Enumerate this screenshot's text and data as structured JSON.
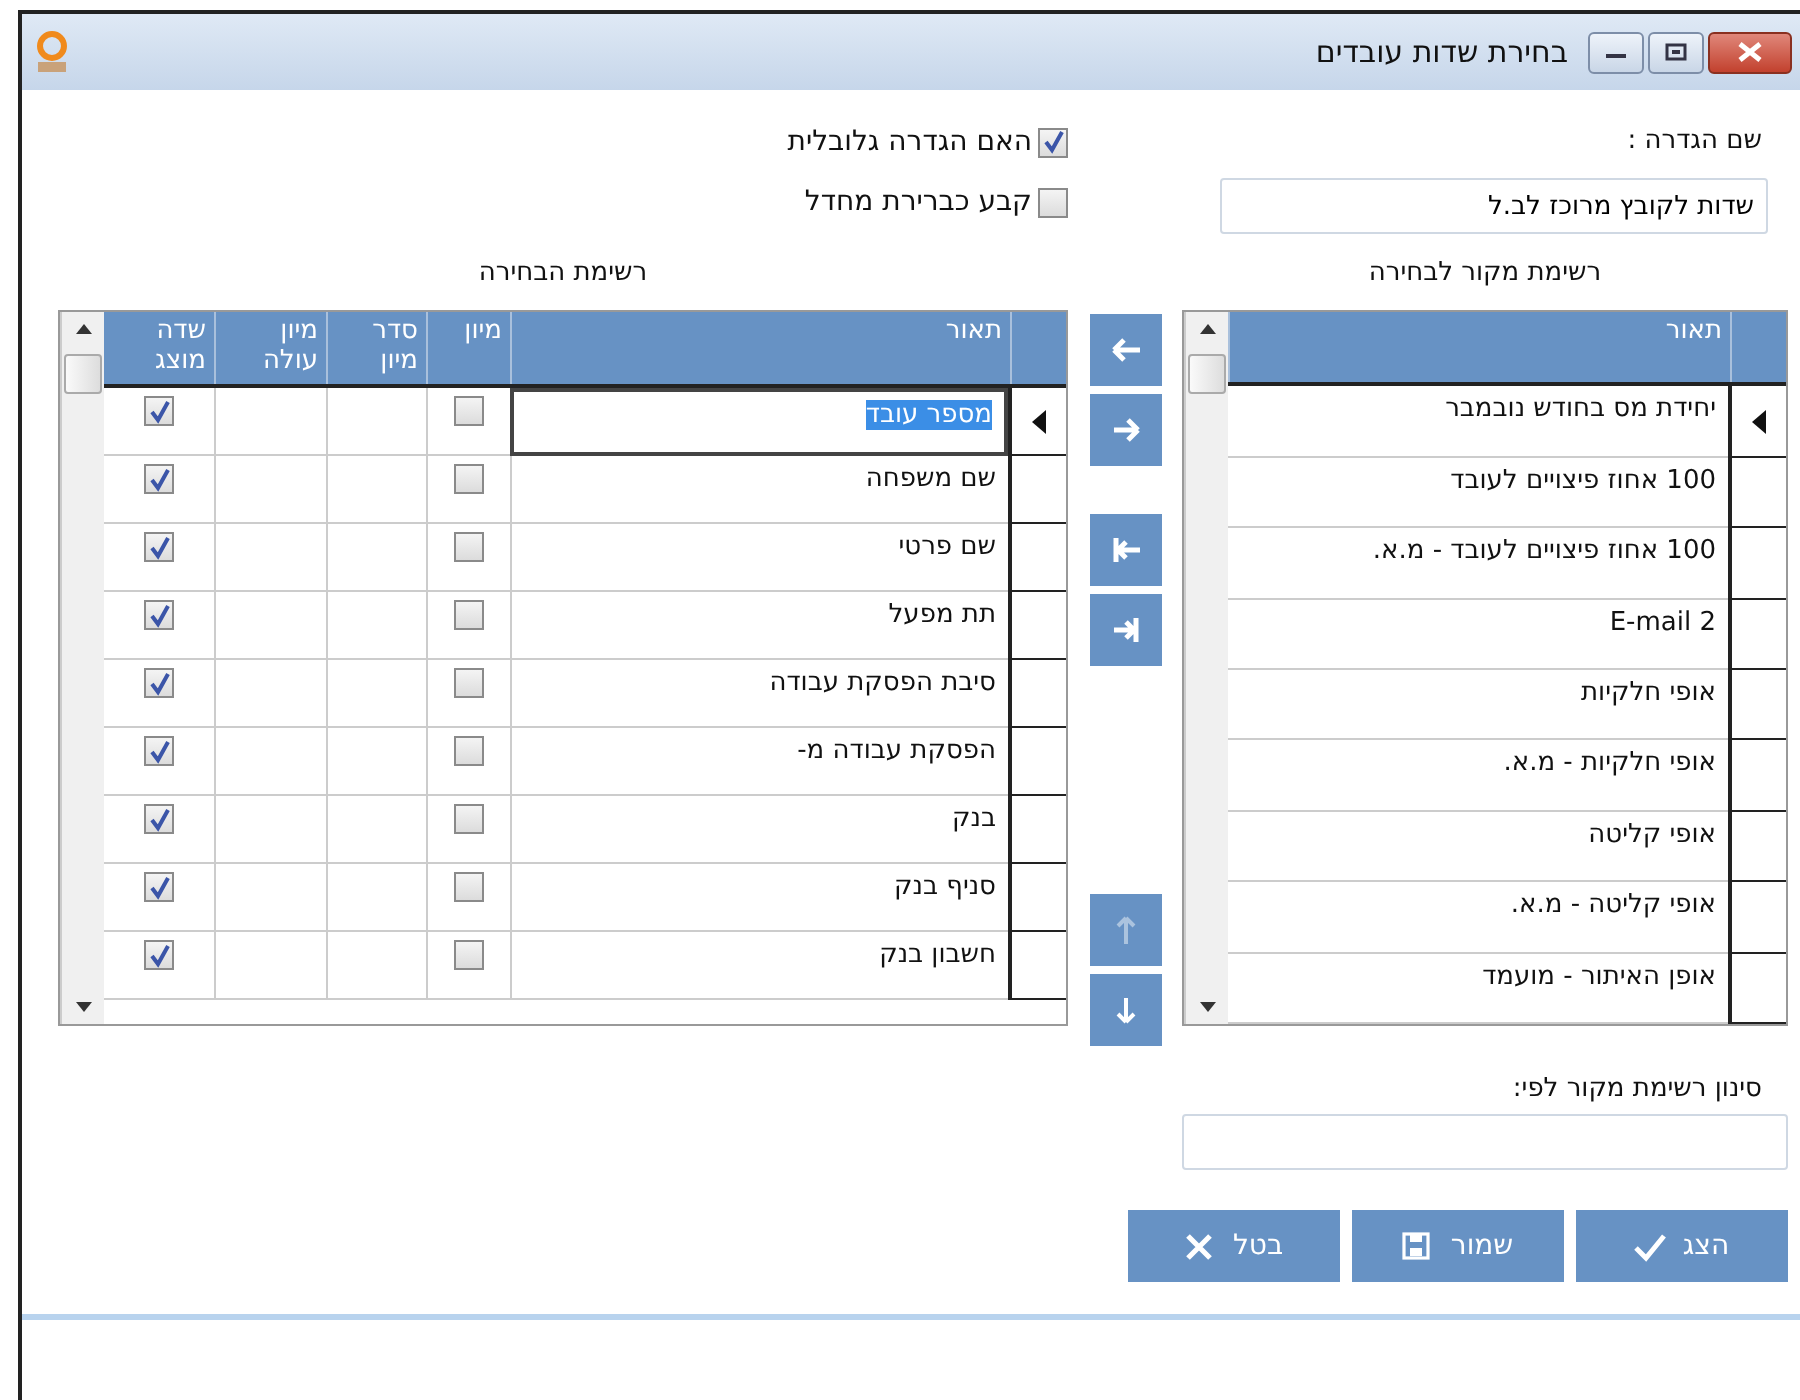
{
  "window": {
    "title": "בחירת שדות עובדים"
  },
  "definition": {
    "label": "שם הגדרה :",
    "value": "שדות לקובץ מרוכז לב.ל"
  },
  "options": [
    {
      "label": "האם הגדרה גלובלית",
      "checked": true
    },
    {
      "label": "קבע כברירת מחדל",
      "checked": false
    }
  ],
  "source_list": {
    "title": "רשימת מקור לבחירה",
    "column": "תאור",
    "rows": [
      {
        "text": "יחידת מס בחודש נובמבר",
        "current": true
      },
      {
        "text": "100 אחוז פיצויים לעובד",
        "current": false
      },
      {
        "text": "100 אחוז פיצויים לעובד - מ.א.",
        "current": false
      },
      {
        "text": "E-mail 2",
        "current": false
      },
      {
        "text": "אופי חלקיות",
        "current": false
      },
      {
        "text": "אופי חלקיות - מ.א.",
        "current": false
      },
      {
        "text": "אופי קליטה",
        "current": false
      },
      {
        "text": "אופי קליטה - מ.א.",
        "current": false
      },
      {
        "text": "אופן האיתור - מועמד",
        "current": false
      }
    ]
  },
  "transfer_buttons": [
    {
      "kind": "left",
      "disabled": false
    },
    {
      "kind": "right",
      "disabled": false
    },
    {
      "kind": "all_left",
      "disabled": false
    },
    {
      "kind": "all_right",
      "disabled": false
    },
    {
      "kind": "up",
      "disabled": true
    },
    {
      "kind": "down",
      "disabled": false
    }
  ],
  "selection_list": {
    "title": "רשימת הבחירה",
    "columns": [
      "תאור",
      "מיון",
      "סדר מיון",
      "מיון עולה",
      "שדה מוצג"
    ],
    "rows": [
      {
        "description": "מספר עובד",
        "sort": false,
        "displayed": true,
        "current": true
      },
      {
        "description": "שם משפחה",
        "sort": false,
        "displayed": true,
        "current": false
      },
      {
        "description": "שם פרטי",
        "sort": false,
        "displayed": true,
        "current": false
      },
      {
        "description": "תת מפעל",
        "sort": false,
        "displayed": true,
        "current": false
      },
      {
        "description": "סיבת הפסקת עבודה",
        "sort": false,
        "displayed": true,
        "current": false
      },
      {
        "description": "הפסקת עבודה מ-",
        "sort": false,
        "displayed": true,
        "current": false
      },
      {
        "description": "בנק",
        "sort": false,
        "displayed": true,
        "current": false
      },
      {
        "description": "סניף בנק",
        "sort": false,
        "displayed": true,
        "current": false
      },
      {
        "description": "חשבון בנק",
        "sort": false,
        "displayed": true,
        "current": false
      }
    ]
  },
  "filter": {
    "label": "סינון רשימת מקור לפי:"
  },
  "buttons": [
    {
      "label": "הצג",
      "kind": "show"
    },
    {
      "label": "שמור",
      "kind": "save"
    },
    {
      "label": "בטל",
      "kind": "cancel"
    }
  ]
}
